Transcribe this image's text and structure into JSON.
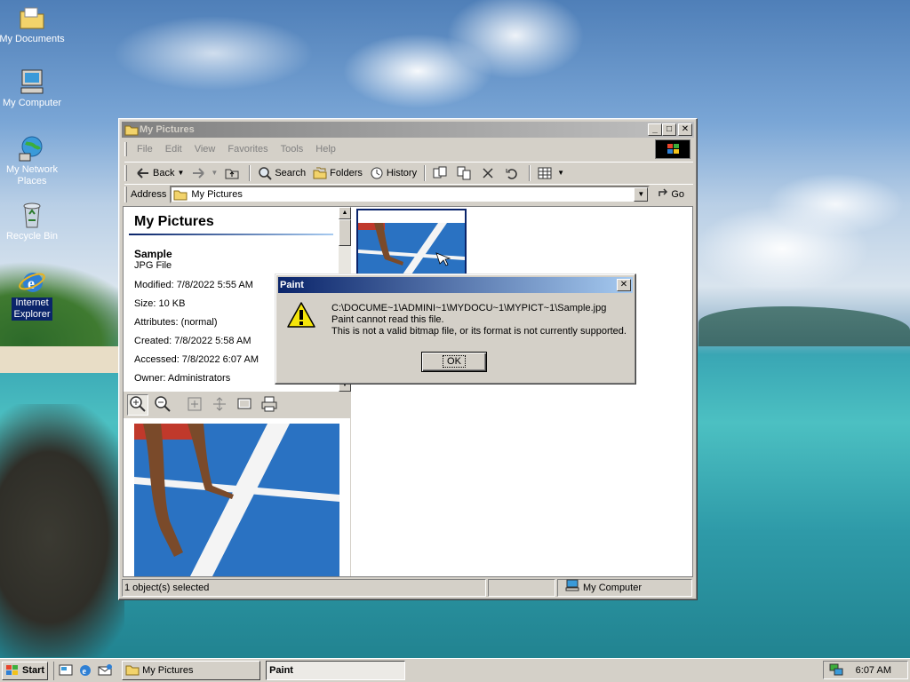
{
  "desktop": {
    "icons": [
      {
        "label": "My Documents"
      },
      {
        "label": "My Computer"
      },
      {
        "label": "My Network Places"
      },
      {
        "label": "Recycle Bin"
      },
      {
        "label": "Internet Explorer"
      }
    ]
  },
  "window": {
    "title": "My Pictures",
    "menu": [
      "File",
      "Edit",
      "View",
      "Favorites",
      "Tools",
      "Help"
    ],
    "toolbar": {
      "back": "Back",
      "search": "Search",
      "folders": "Folders",
      "history": "History"
    },
    "address": {
      "label": "Address",
      "value": "My Pictures",
      "go": "Go"
    },
    "info": {
      "heading": "My Pictures",
      "file_name": "Sample",
      "file_type": "JPG File",
      "modified": "Modified: 7/8/2022 5:55 AM",
      "size": "Size: 10 KB",
      "attributes": "Attributes: (normal)",
      "created": "Created: 7/8/2022 5:58 AM",
      "accessed": "Accessed: 7/8/2022 6:07 AM",
      "owner": "Owner: Administrators"
    },
    "status": {
      "selected": "1 object(s) selected",
      "zone": "My Computer"
    }
  },
  "dialog": {
    "title": "Paint",
    "path": "C:\\DOCUME~1\\ADMINI~1\\MYDOCU~1\\MYPICT~1\\Sample.jpg",
    "line1": "Paint cannot read this file.",
    "line2": "This is not a valid bitmap file, or its format is not currently supported.",
    "ok": "OK"
  },
  "taskbar": {
    "start": "Start",
    "tasks": [
      "My Pictures",
      "Paint"
    ],
    "clock": "6:07 AM"
  },
  "colors": {
    "title_active": "#0a246a",
    "title_inactive": "#808080",
    "face": "#d4d0c8"
  }
}
